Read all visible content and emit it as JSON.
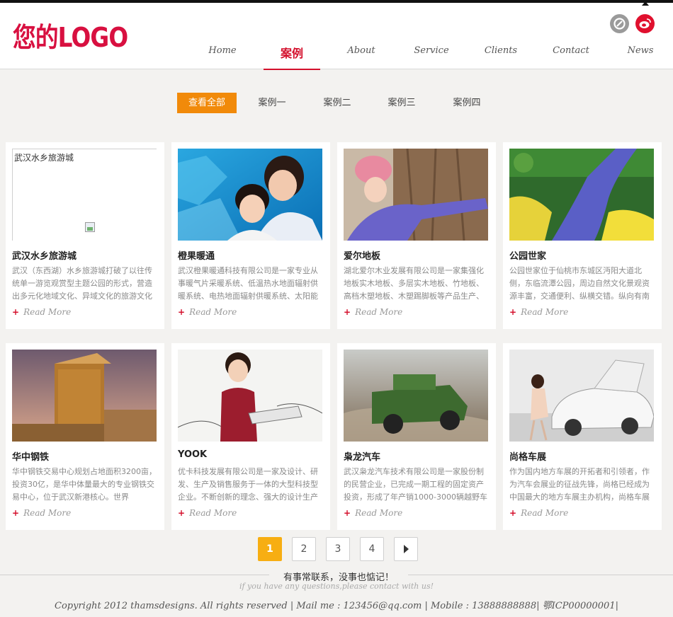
{
  "header": {
    "logo": "您的LOGO",
    "nav": [
      "Home",
      "案例",
      "About",
      "Service",
      "Clients",
      "Contact",
      "News"
    ],
    "active_nav": "案例"
  },
  "filters": [
    "查看全部",
    "案例一",
    "案例二",
    "案例三",
    "案例四"
  ],
  "cards": [
    {
      "title": "武汉水乡旅游城",
      "desc": "武汉（东西湖）水乡旅游城打破了以往传统单一游览观赏型主题公园的形式，营造出多元化地域文化、异域文化的旅游文化",
      "more": "Read More",
      "image_alt": "武汉水乡旅游城"
    },
    {
      "title": "橙果暖通",
      "desc": "武汉橙果暖通科技有限公司是一家专业从事暖气片采暖系统、低温热水地面辐射供暖系统、电热地面辐射供暖系统、太阳能",
      "more": "Read More"
    },
    {
      "title": "爱尔地板",
      "desc": "湖北爱尔木业发展有限公司是一家集强化地板实木地板、多层实木地板、竹地板、高档木塑地板、木塑踢脚板等产品生产、",
      "more": "Read More"
    },
    {
      "title": "公园世家",
      "desc": "公园世家位于仙桃市东城区沔阳大道北侧，东临流潭公园，周边自然文化景观资源丰富，交通便利、纵横交错。纵向有南",
      "more": "Read More"
    },
    {
      "title": "华中钢铁",
      "desc": "华中钢铁交易中心规划占地面积3200亩，投资30亿，是华中体量最大的专业钢铁交易中心，位于武汉新港核心。世界",
      "more": "Read More"
    },
    {
      "title": "YOOK",
      "desc": "优卡科技发展有限公司是一家及设计、研发、生产及销售服务于一体的大型科技型企业。不断创新的理念、强大的设计生产",
      "more": "Read More"
    },
    {
      "title": "枭龙汽车",
      "desc": "武汉枭龙汽车技术有限公司是一家股份制的民营企业，已完成一期工程的固定资产投资，形成了年产销1000-3000辆越野车",
      "more": "Read More"
    },
    {
      "title": "尚格车展",
      "desc": "作为国内地方车展的开拓者和引领者，作为汽车会展业的征战先锋，尚格已经成为中国最大的地方车展主办机构，尚格车展",
      "more": "Read More"
    }
  ],
  "pagination": [
    "1",
    "2",
    "3",
    "4"
  ],
  "active_page": "1",
  "footer": {
    "tagline": "有事常联系，没事也惦记！",
    "sub": "if you have any questions,please contact with us!",
    "copyright": "Copyright 2012 thamsdesigns. All rights reserved | Mail me : 123456@qq.com | Mobile : 13888888888| 鄂ICP00000001|"
  },
  "colors": {
    "accent": "#d4102c",
    "filter_active": "#f18a0a",
    "page_active": "#f7ae12"
  }
}
